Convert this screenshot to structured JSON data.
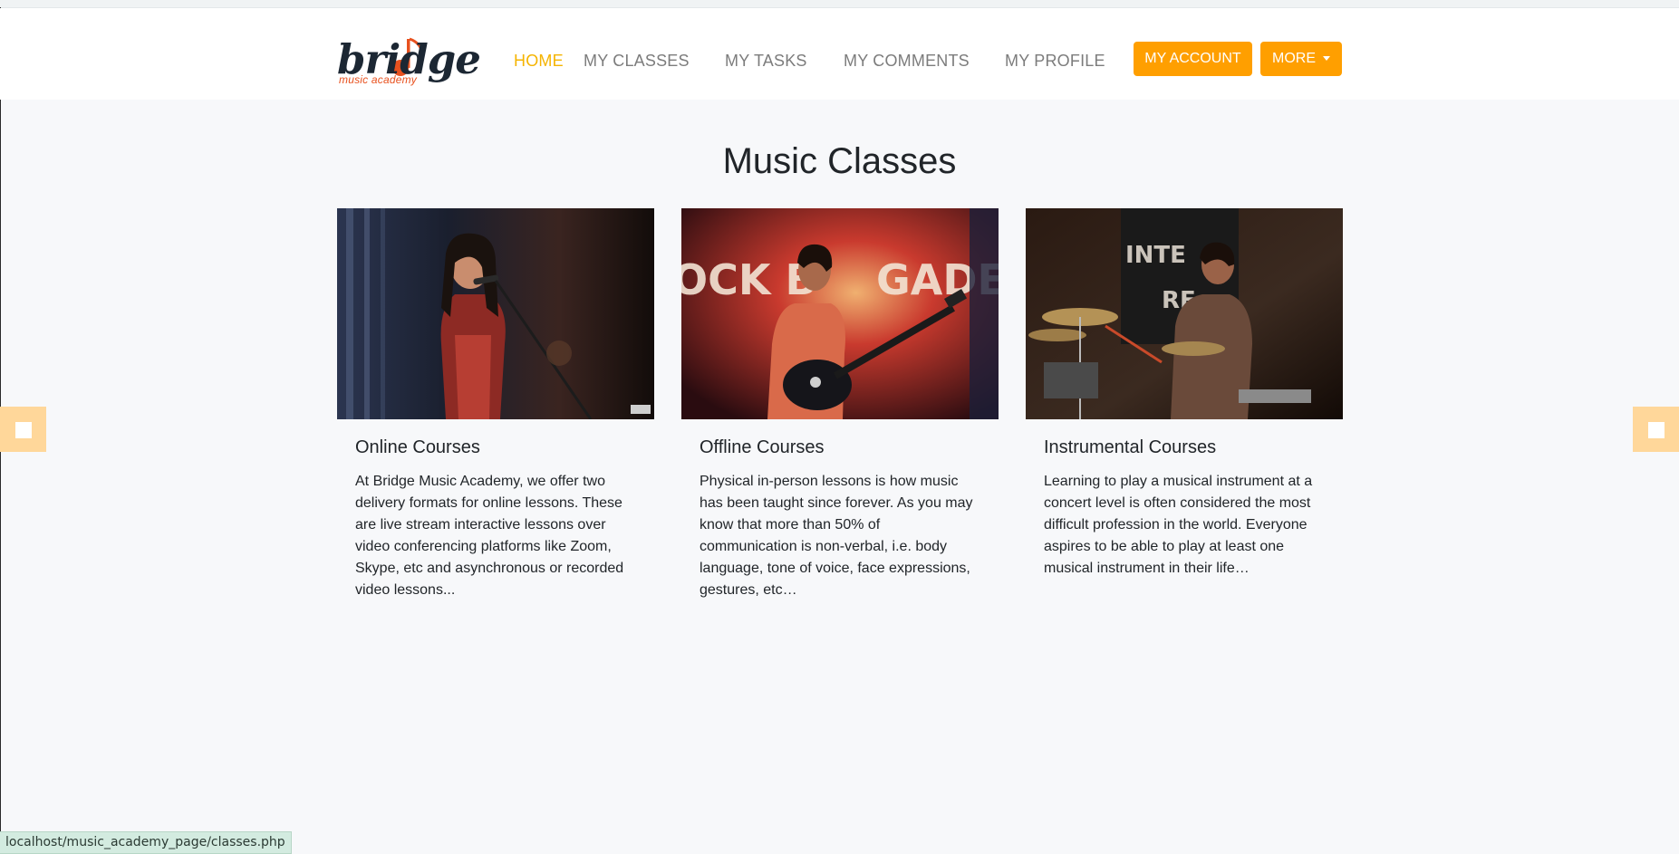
{
  "brand": {
    "name": "bridge",
    "tagline": "music academy"
  },
  "nav": [
    {
      "label": "HOME",
      "active": true
    },
    {
      "label": "MY CLASSES"
    },
    {
      "label": "MY TASKS"
    },
    {
      "label": "MY COMMENTS"
    },
    {
      "label": "MY PROFILE"
    }
  ],
  "buttons": {
    "account": "MY ACCOUNT",
    "more": "MORE"
  },
  "page_title": "Music Classes",
  "cards": [
    {
      "title": "Online Courses",
      "text": "At Bridge Music Academy, we offer two delivery formats for online lessons. These are live stream interactive lessons over video conferencing platforms like Zoom, Skype, etc and asynchronous or recorded video lessons..."
    },
    {
      "title": "Offline Courses",
      "text": "Physical in-person lessons is how music has been taught since forever. As you may know that more than 50% of communication is non-verbal, i.e. body language, tone of voice, face expressions, gestures, etc…"
    },
    {
      "title": "Instrumental Courses",
      "text": "Learning to play a musical instrument at a concert level is often considered the most difficult profession in the world. Everyone aspires to be able to play at least one musical instrument in their life…"
    }
  ],
  "status_url": "localhost/music_academy_page/classes.php",
  "colors": {
    "accent": "#ff9f00",
    "active_nav": "#f5b400",
    "logo_dark": "#1c2733",
    "logo_orange": "#e8511e"
  }
}
